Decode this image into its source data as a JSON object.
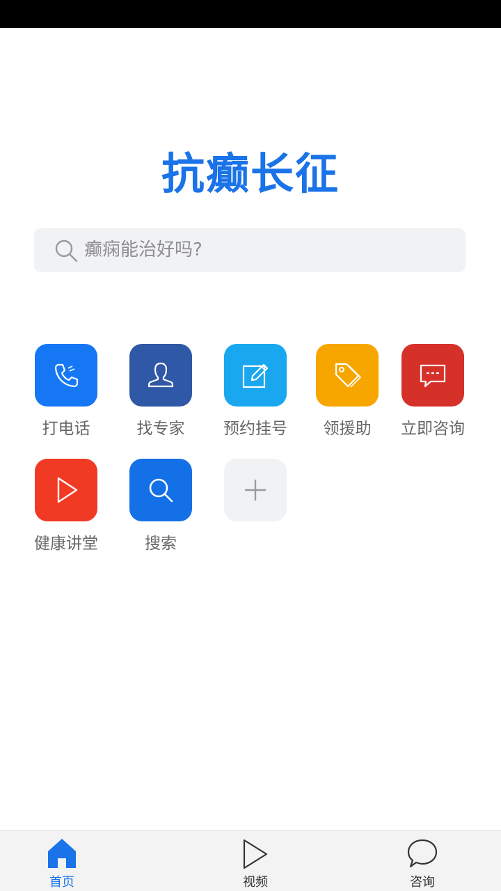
{
  "app": {
    "title": "抗癫长征",
    "title_color": "#1a73e8"
  },
  "search": {
    "placeholder": "癫痫能治好吗?",
    "icon": "search-icon"
  },
  "services": [
    {
      "label": "打电话",
      "icon": "phone-icon",
      "color": "#1677f5"
    },
    {
      "label": "找专家",
      "icon": "user-icon",
      "color": "#2f58a6"
    },
    {
      "label": "预约挂号",
      "icon": "edit-icon",
      "color": "#19a8ef"
    },
    {
      "label": "领援助",
      "icon": "tag-icon",
      "color": "#f7a600"
    },
    {
      "label": "立即咨询",
      "icon": "chat-icon",
      "color": "#d53128"
    },
    {
      "label": "健康讲堂",
      "icon": "play-icon",
      "color": "#f03a24"
    },
    {
      "label": "搜索",
      "icon": "search-icon",
      "color": "#1470e6"
    },
    {
      "label": "",
      "icon": "plus-icon",
      "color": "#f1f2f4"
    }
  ],
  "tabbar": {
    "tabs": [
      {
        "label": "首页",
        "icon": "home-icon",
        "active": true
      },
      {
        "label": "视频",
        "icon": "play-icon",
        "active": false
      },
      {
        "label": "咨询",
        "icon": "chat-bubble-icon",
        "active": false
      }
    ],
    "active_color": "#1a73e8"
  }
}
